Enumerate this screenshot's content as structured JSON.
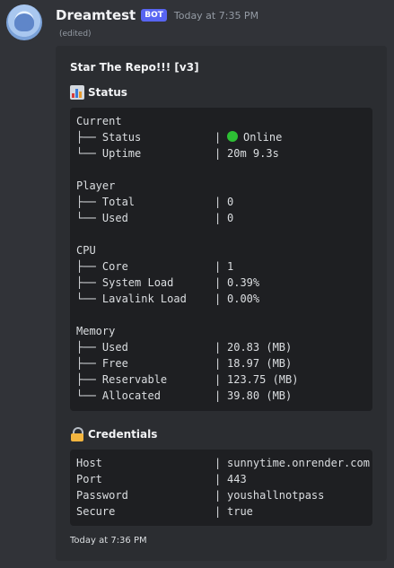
{
  "message": {
    "username": "Dreamtest",
    "bot_badge": "BOT",
    "timestamp": "Today at 7:35 PM",
    "edited": "(edited)"
  },
  "embed": {
    "title": "Star The Repo!!! [v3]",
    "status_field": {
      "icon": "bar-chart-icon",
      "name": "Status",
      "lines": [
        {
          "label": "Current",
          "sep": "",
          "value": ""
        },
        {
          "label": "├── Status",
          "sep": "|",
          "value": "Online",
          "status_dot_color": "#2dbf34"
        },
        {
          "label": "└── Uptime",
          "sep": "|",
          "value": "20m 9.3s"
        },
        {
          "label": "",
          "sep": "",
          "value": ""
        },
        {
          "label": "Player",
          "sep": "",
          "value": ""
        },
        {
          "label": "├── Total",
          "sep": "|",
          "value": "0"
        },
        {
          "label": "└── Used",
          "sep": "|",
          "value": "0"
        },
        {
          "label": "",
          "sep": "",
          "value": ""
        },
        {
          "label": "CPU",
          "sep": "",
          "value": ""
        },
        {
          "label": "├── Core",
          "sep": "|",
          "value": "1"
        },
        {
          "label": "├── System Load",
          "sep": "|",
          "value": "0.39%"
        },
        {
          "label": "└── Lavalink Load",
          "sep": "|",
          "value": "0.00%"
        },
        {
          "label": "",
          "sep": "",
          "value": ""
        },
        {
          "label": "Memory",
          "sep": "",
          "value": ""
        },
        {
          "label": "├── Used",
          "sep": "|",
          "value": "20.83 (MB)"
        },
        {
          "label": "├── Free",
          "sep": "|",
          "value": "18.97 (MB)"
        },
        {
          "label": "├── Reservable",
          "sep": "|",
          "value": "123.75 (MB)"
        },
        {
          "label": "└── Allocated",
          "sep": "|",
          "value": "39.80 (MB)"
        }
      ]
    },
    "credentials_field": {
      "icon": "lock-icon",
      "name": "Credentials",
      "lines": [
        {
          "label": "Host",
          "sep": "|",
          "value": "sunnytime.onrender.com"
        },
        {
          "label": "Port",
          "sep": "|",
          "value": "443"
        },
        {
          "label": "Password",
          "sep": "|",
          "value": "youshallnotpass"
        },
        {
          "label": "Secure",
          "sep": "|",
          "value": "true"
        }
      ]
    },
    "footer_timestamp": "Today at 7:36 PM"
  },
  "colors": {
    "background": "#313338",
    "embed_background": "#2b2d31",
    "code_background": "#1e1f22",
    "bot_badge": "#5865f2",
    "online": "#2dbf34"
  }
}
